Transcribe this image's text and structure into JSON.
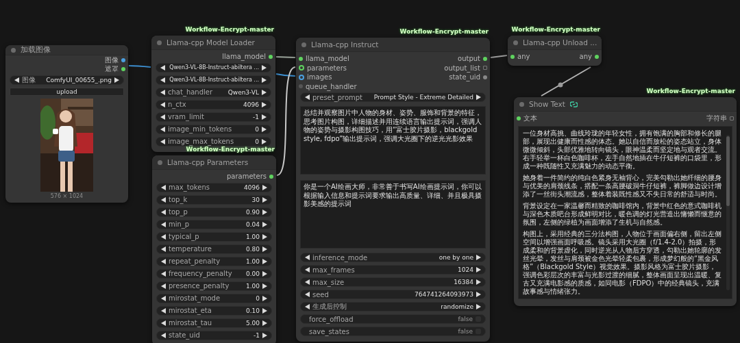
{
  "nodes": [
    {
      "kind": "load_image",
      "title": "加载图像",
      "outputs": [
        {
          "label": "图像",
          "kind": "dot",
          "color": "#4a9fe0"
        },
        {
          "label": "遮罩",
          "kind": "dot",
          "color": "#5fd35f"
        }
      ],
      "widgets": [
        {
          "kind": "combo",
          "label": "图像",
          "value": "ComfyUI_00655_.png"
        },
        {
          "kind": "button",
          "label": "upload"
        },
        {
          "kind": "preview",
          "caption": "576 × 1024"
        }
      ]
    },
    {
      "kind": "model_loader",
      "badge": "Workflow-Encrypt-master",
      "title": "Llama-cpp Model Loader",
      "outputs": [
        {
          "label": "llama_model",
          "kind": "dot",
          "color": "#5fd35f"
        }
      ],
      "widgets": [
        {
          "kind": "combo",
          "value": "Qwen3-VL-8B-Instruct-abiltera ..."
        },
        {
          "kind": "combo",
          "value": "Qwen3-VL-8B-Instruct-abiltera ..."
        },
        {
          "kind": "combo",
          "label": "chat_handler",
          "value": "Qwen3-VL"
        },
        {
          "kind": "number",
          "label": "n_ctx",
          "value": "4096"
        },
        {
          "kind": "number",
          "label": "vram_limit",
          "value": "-1"
        },
        {
          "kind": "number",
          "label": "image_min_tokens",
          "value": "0"
        },
        {
          "kind": "number",
          "label": "image_max_tokens",
          "value": "0"
        }
      ]
    },
    {
      "kind": "parameters",
      "badge": "Workflow-Encrypt-master",
      "title": "Llama-cpp Parameters",
      "outputs": [
        {
          "label": "parameters",
          "kind": "dot",
          "color": "#5fd35f"
        }
      ],
      "widgets": [
        {
          "kind": "number",
          "label": "max_tokens",
          "value": "4096"
        },
        {
          "kind": "number",
          "label": "top_k",
          "value": "30"
        },
        {
          "kind": "number",
          "label": "top_p",
          "value": "0.90"
        },
        {
          "kind": "number",
          "label": "min_p",
          "value": "0.04"
        },
        {
          "kind": "number",
          "label": "typical_p",
          "value": "1.00"
        },
        {
          "kind": "number",
          "label": "temperature",
          "value": "0.80"
        },
        {
          "kind": "number",
          "label": "repeat_penalty",
          "value": "1.00"
        },
        {
          "kind": "number",
          "label": "frequency_penalty",
          "value": "0.00"
        },
        {
          "kind": "number",
          "label": "presence_penalty",
          "value": "1.00"
        },
        {
          "kind": "number",
          "label": "mirostat_mode",
          "value": "0"
        },
        {
          "kind": "number",
          "label": "mirostat_eta",
          "value": "0.10"
        },
        {
          "kind": "number",
          "label": "mirostat_tau",
          "value": "5.00"
        },
        {
          "kind": "number",
          "label": "state_uid",
          "value": "-1"
        }
      ]
    },
    {
      "kind": "instruct",
      "badge": "Workflow-Encrypt-master",
      "title": "Llama-cpp Instruct",
      "inputs": [
        {
          "label": "llama_model",
          "kind": "dot",
          "color": "#5fd35f"
        },
        {
          "label": "parameters",
          "kind": "ring",
          "color": "#5fd35f"
        },
        {
          "label": "images",
          "kind": "ring",
          "color": "#4a9fe0"
        },
        {
          "label": "queue_handler",
          "kind": "dot",
          "color": "#555555"
        }
      ],
      "outputs": [
        {
          "label": "output",
          "kind": "dot",
          "color": "#5fd35f"
        },
        {
          "label": "output_list",
          "kind": "grid",
          "color": "#777777"
        },
        {
          "label": "state_uid",
          "kind": "dot",
          "color": "#888888"
        }
      ],
      "widgets": [
        {
          "kind": "combo",
          "label": "preset_prompt",
          "value": "Prompt Style - Extreme Detailed"
        },
        {
          "kind": "text",
          "value": "总结并观察图片中人物的身材、姿势、服饰和背景的特征，思考图片构图，详细描述并用连续语言输出提示词，强调人物的姿势与摄影构图技巧，用“富士胶片摄影，blackgold style, fdpo”输出提示词，强调大光圈下的逆光光影效果"
        },
        {
          "kind": "text",
          "value": "你是一个AI绘画大师，非常善于书写AI绘画提示词，你可以根据输入信息和提示词要求输出高质量、详细、并且极具摄影美感的提示词"
        },
        {
          "kind": "combo",
          "label": "inference_mode",
          "value": "one by one"
        },
        {
          "kind": "number",
          "label": "max_frames",
          "value": "1024"
        },
        {
          "kind": "number",
          "label": "max_size",
          "value": "16384"
        },
        {
          "kind": "number",
          "label": "seed",
          "value": "764741264093973"
        },
        {
          "kind": "combo",
          "label": "生成后控制",
          "value": "randomize"
        },
        {
          "kind": "toggle",
          "label": "force_offload",
          "value": "false",
          "on": false
        },
        {
          "kind": "toggle",
          "label": "save_states",
          "value": "false",
          "on": false
        }
      ]
    },
    {
      "kind": "unload",
      "badge": "Workflow-Encrypt-master",
      "title": "Llama-cpp Unload ...",
      "inputs": [
        {
          "label": "any",
          "kind": "dot",
          "color": "#5fd35f"
        }
      ],
      "outputs": [
        {
          "label": "any",
          "kind": "dot",
          "color": "#5fd35f"
        }
      ]
    },
    {
      "kind": "show_text",
      "badge": "Workflow-Encrypt-master",
      "title": "Show Text",
      "inputs": [
        {
          "label": "文本",
          "kind": "dot",
          "color": "#5fd35f"
        }
      ],
      "outputs": [
        {
          "label": "字符串",
          "kind": "grid",
          "color": "#777777"
        }
      ],
      "widgets": [
        {
          "kind": "readout",
          "paragraphs": [
            "一位身材高挑、曲线玲珑的年轻女性，拥有饱满的胸部和修长的腿部，展现出健康而性感的体态。她以自信而放松的姿态站立，身体微微倾斜，头部优雅地转向镜头，眼神温柔而坚定地与观者交流。右手轻举一杯白色咖啡杯，左手自然地插在牛仔短裤的口袋里，形成一种既随性又充满魅力的动态平衡。",
            "她身着一件简约的纯白色紧身无袖背心，完美勾勒出她纤细的腰身与优美的肩颈线条，搭配一条高腰破洞牛仔短裤，裤脚做边设计增添了一丝街头潮流感，整体着装既性感又不失日常的舒适与时尚。",
            "背景设定在一家温馨而精致的咖啡馆内，背景中红色的意式咖啡机与深色木质吧台形成鲜明对比，暖色调的灯光营造出慵懒而惬意的氛围，左侧的绿植为画面增添了生机与自然感。",
            "构图上，采用经典的三分法构图，人物位于画面偏右侧，留出左侧空间以增强画面呼吸感。镜头采用大光圈（f/1.4-2.0）拍摄，形成柔和的背景虚化，同时逆光从人物后方穿透，勾勒出她轮廓的发丝光晕，发丝与肩颈被金色光晕轻柔包裹，形成梦幻般的“黑金风格”（Blackgold Style）视觉效果。摄影风格为富士胶片摄影，强调色彩层次的丰富与光影过渡的细腻，整体画面呈现出温暖、复古又充满电影感的质感，如同电影（FDPO）中的经典镜头，充满故事感与情绪张力。"
          ]
        }
      ]
    }
  ]
}
